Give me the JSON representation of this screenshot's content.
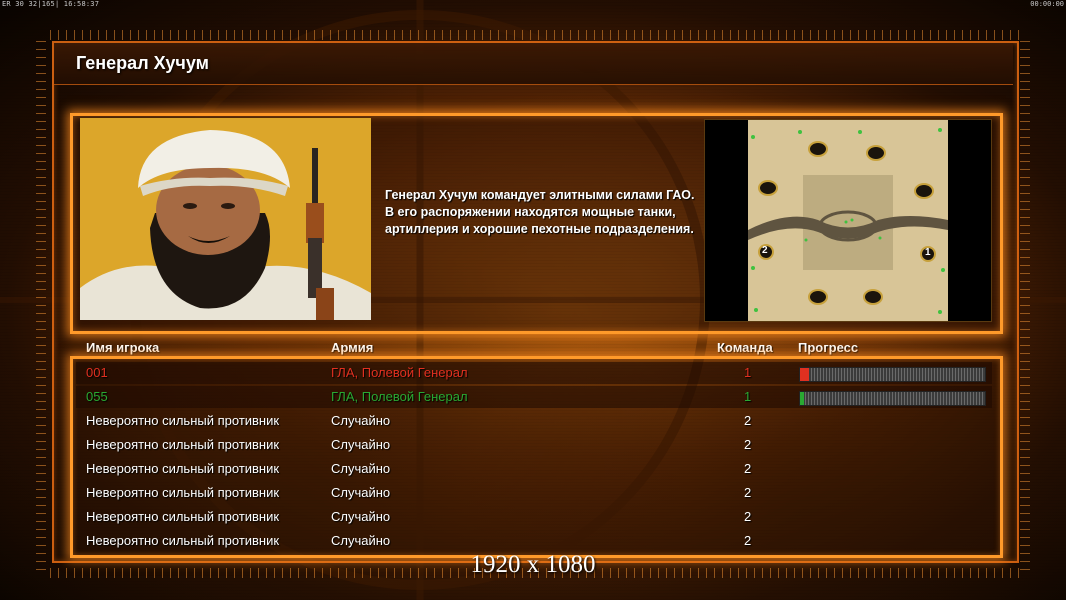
{
  "status": {
    "left_text": "ER 30 32|165| 16:58:37",
    "right_text": "00:00:00"
  },
  "page_title": "Генерал Хучум",
  "description": "Генерал Хучум командует элитными силами ГАО. В его распоряжении находятся мощные танки, артиллерия и хорошие пехотные подразделения.",
  "table": {
    "headers": {
      "name": "Имя игрока",
      "army": "Армия",
      "team": "Команда",
      "progress": "Прогресс"
    },
    "rows": [
      {
        "name": "001",
        "army": "ГЛА, Полевой Генерал",
        "team": "1",
        "color": "#e03020",
        "progress": 0.05
      },
      {
        "name": "055",
        "army": "ГЛА, Полевой Генерал",
        "team": "1",
        "color": "#2aa832",
        "progress": 0.02
      },
      {
        "name": "Невероятно сильный противник",
        "army": "Случайно",
        "team": "2",
        "color": "#ffffff"
      },
      {
        "name": "Невероятно сильный противник",
        "army": "Случайно",
        "team": "2",
        "color": "#ffffff"
      },
      {
        "name": "Невероятно сильный противник",
        "army": "Случайно",
        "team": "2",
        "color": "#ffffff"
      },
      {
        "name": "Невероятно сильный противник",
        "army": "Случайно",
        "team": "2",
        "color": "#ffffff"
      },
      {
        "name": "Невероятно сильный противник",
        "army": "Случайно",
        "team": "2",
        "color": "#ffffff"
      },
      {
        "name": "Невероятно сильный противник",
        "army": "Случайно",
        "team": "2",
        "color": "#ffffff"
      }
    ]
  },
  "minimap": {
    "start_labels": [
      "2",
      "1"
    ]
  },
  "resolution_label": "1920 x 1080",
  "colors": {
    "accent": "#ff9a2a",
    "player_red": "#e03020",
    "player_green": "#2aa832"
  }
}
